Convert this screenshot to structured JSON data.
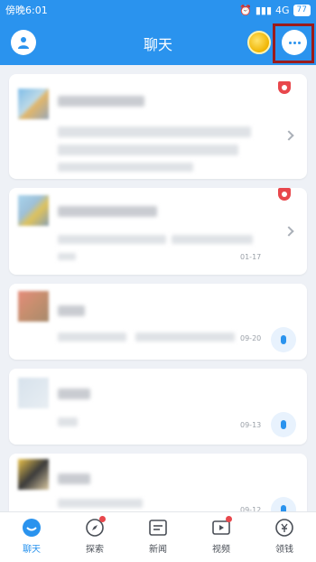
{
  "statusbar": {
    "time": "傍晚6:01",
    "network": "4G",
    "battery": "77"
  },
  "header": {
    "title": "聊天"
  },
  "list": {
    "items": [
      {
        "date": ""
      },
      {
        "date": "01-17"
      },
      {
        "date": "09-20"
      },
      {
        "date": "09-13"
      },
      {
        "date": "09-12"
      }
    ]
  },
  "nav": [
    {
      "label": "聊天",
      "icon": "chat-icon",
      "active": true
    },
    {
      "label": "探索",
      "icon": "compass-icon",
      "active": false
    },
    {
      "label": "新闻",
      "icon": "news-icon",
      "active": false
    },
    {
      "label": "视频",
      "icon": "video-icon",
      "active": false
    },
    {
      "label": "领钱",
      "icon": "money-icon",
      "active": false
    }
  ],
  "colors": {
    "primary": "#2a93ee",
    "badge": "#e8474c",
    "highlight": "#9b1b1b"
  }
}
